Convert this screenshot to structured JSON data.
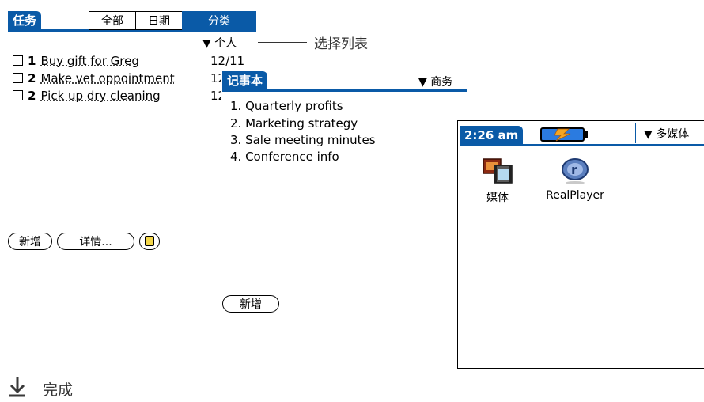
{
  "tasks": {
    "title": "任务",
    "tabs": [
      {
        "label": "全部",
        "selected": false
      },
      {
        "label": "日期",
        "selected": false
      },
      {
        "label": "分类",
        "selected": true
      }
    ],
    "category": "个人",
    "items": [
      {
        "priority": "1",
        "desc": "Buy gift for Greg",
        "due": "12/11"
      },
      {
        "priority": "2",
        "desc": "Make vet oppointment",
        "due": "12"
      },
      {
        "priority": "2",
        "desc": "Pick up dry cleaning",
        "due": "12"
      }
    ],
    "buttons": {
      "new": "新增",
      "details": "详情..."
    }
  },
  "callout": {
    "label": "选择列表"
  },
  "memos": {
    "title": "记事本",
    "category": "商务",
    "items": [
      "1. Quarterly profits",
      "2. Marketing strategy",
      "3. Sale meeting minutes",
      "4. Conference info"
    ],
    "buttons": {
      "new": "新增"
    }
  },
  "launcher": {
    "time": "2:26 am",
    "category": "多媒体",
    "apps": [
      {
        "label": "媒体",
        "icon": "media-icon"
      },
      {
        "label": "RealPlayer",
        "icon": "realplayer-icon"
      }
    ],
    "colors": {
      "battery_fill": "#2b7be0",
      "bolt": "#f5a623"
    }
  },
  "footer": {
    "label": "完成",
    "icon": "arrow-down-icon"
  },
  "colors": {
    "accent": "#0a5aa7"
  }
}
